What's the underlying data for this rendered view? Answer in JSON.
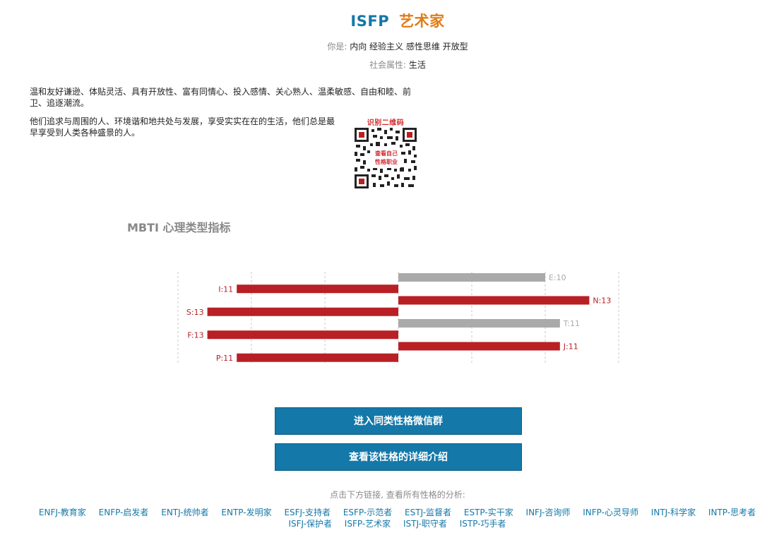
{
  "header": {
    "type_code": "ISFP",
    "type_name": "艺术家",
    "you_are_label": "你是:",
    "you_are_value": "内向 经验主义 感性思维 开放型",
    "social_label": "社会属性:",
    "social_value": "生活"
  },
  "description": {
    "para1": "温和友好谦逊、体贴灵活、具有开放性、富有同情心、投入感情、关心熟人、温柔敏感、自由和睦、前卫、追逐潮流。",
    "para2": "他们追求与周围的人、环境谐和地共处与发展，享受实实在在的生活，他们总是最早享受到人类各种盛景的人。"
  },
  "qr": {
    "title": "识别二维码",
    "overlay_line1": "查看自己",
    "overlay_line2": "性格职业"
  },
  "chart_title": "MBTI 心理类型指标",
  "chart_data": {
    "type": "bar",
    "orientation": "horizontal-diverging",
    "categories": [
      "E/I",
      "E/I",
      "S/N",
      "S/N",
      "T/F",
      "T/F",
      "J/P",
      "J/P"
    ],
    "bars": [
      {
        "label": "E:10",
        "value": 10,
        "side": "right",
        "dominant": false
      },
      {
        "label": "I:11",
        "value": 11,
        "side": "left",
        "dominant": true
      },
      {
        "label": "N:13",
        "value": 13,
        "side": "right",
        "dominant": true
      },
      {
        "label": "S:13",
        "value": 13,
        "side": "left",
        "dominant": true
      },
      {
        "label": "T:11",
        "value": 11,
        "side": "right",
        "dominant": false
      },
      {
        "label": "F:13",
        "value": 13,
        "side": "left",
        "dominant": true
      },
      {
        "label": "J:11",
        "value": 11,
        "side": "right",
        "dominant": true
      },
      {
        "label": "P:11",
        "value": 11,
        "side": "left",
        "dominant": true
      }
    ],
    "xlim": [
      -15,
      15
    ],
    "grid": true,
    "colors": {
      "dominant": "#b82025",
      "other": "#aaaaaa"
    }
  },
  "buttons": {
    "join_group": "进入同类性格微信群",
    "details": "查看该性格的详细介绍"
  },
  "links": {
    "hint": "点击下方链接, 查看所有性格的分析:",
    "row1": [
      "ENFJ-教育家",
      "ENFP-启发者",
      "ENTJ-统帅者",
      "ENTP-发明家",
      "ESFJ-支持者",
      "ESFP-示范者",
      "ESTJ-监督者",
      "ESTP-实干家",
      "INFJ-咨询师",
      "INFP-心灵导师",
      "INTJ-科学家",
      "INTP-思考者"
    ],
    "row2": [
      "ISFJ-保护者",
      "ISFP-艺术家",
      "ISTJ-职守者",
      "ISTP-巧手者"
    ]
  }
}
